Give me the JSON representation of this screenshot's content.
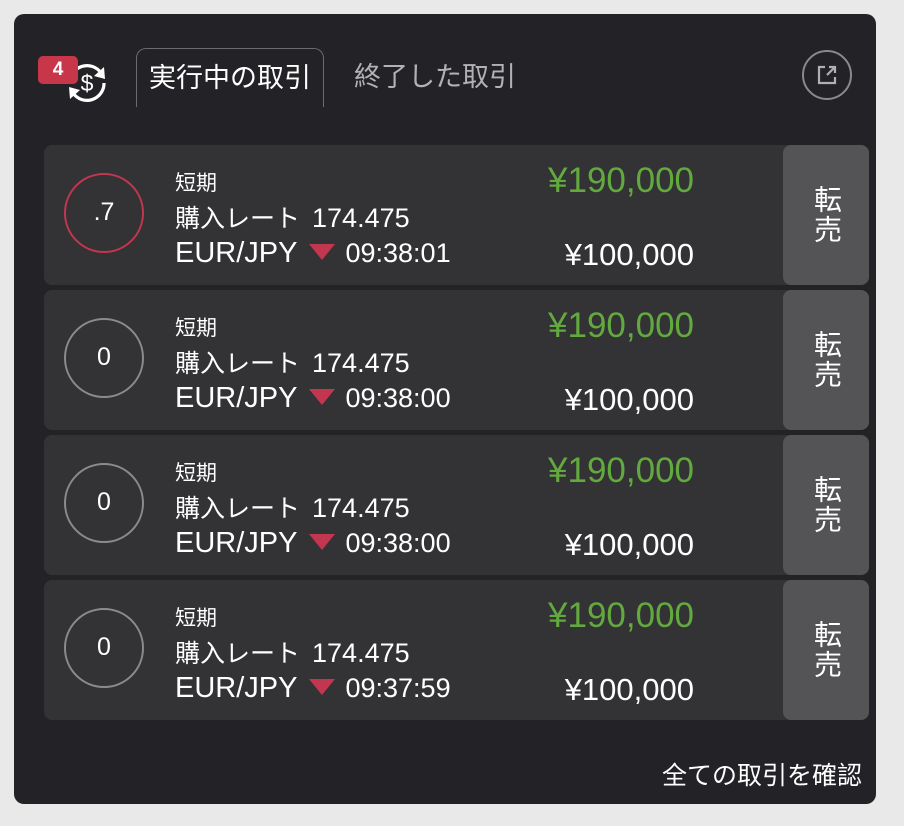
{
  "header": {
    "badge_count": "4",
    "tabs": [
      {
        "label": "実行中の取引",
        "active": true
      },
      {
        "label": "終了した取引",
        "active": false
      }
    ],
    "icons": {
      "exchange": "dollar-exchange-icon",
      "external": "external-link-icon"
    }
  },
  "trades": [
    {
      "timer": ".7",
      "timer_color": "#c23650",
      "term": "短期",
      "rate_label": "購入レート",
      "rate": "174.475",
      "pair": "EUR/JPY",
      "direction": "down",
      "time": "09:38:01",
      "payout": "¥190,000",
      "stake": "¥100,000",
      "resell_label": "転売"
    },
    {
      "timer": "0",
      "timer_color": "#8b8b8f",
      "term": "短期",
      "rate_label": "購入レート",
      "rate": "174.475",
      "pair": "EUR/JPY",
      "direction": "down",
      "time": "09:38:00",
      "payout": "¥190,000",
      "stake": "¥100,000",
      "resell_label": "転売"
    },
    {
      "timer": "0",
      "timer_color": "#8b8b8f",
      "term": "短期",
      "rate_label": "購入レート",
      "rate": "174.475",
      "pair": "EUR/JPY",
      "direction": "down",
      "time": "09:38:00",
      "payout": "¥190,000",
      "stake": "¥100,000",
      "resell_label": "転売"
    },
    {
      "timer": "0",
      "timer_color": "#8b8b8f",
      "term": "短期",
      "rate_label": "購入レート",
      "rate": "174.475",
      "pair": "EUR/JPY",
      "direction": "down",
      "time": "09:37:59",
      "payout": "¥190,000",
      "stake": "¥100,000",
      "resell_label": "転売"
    }
  ],
  "footer": {
    "view_all": "全ての取引を確認"
  },
  "colors": {
    "panel": "#232226",
    "row": "#333336",
    "resell": "#545457",
    "payout": "#62a93e",
    "down": "#c23650",
    "badge": "#c8364a"
  }
}
